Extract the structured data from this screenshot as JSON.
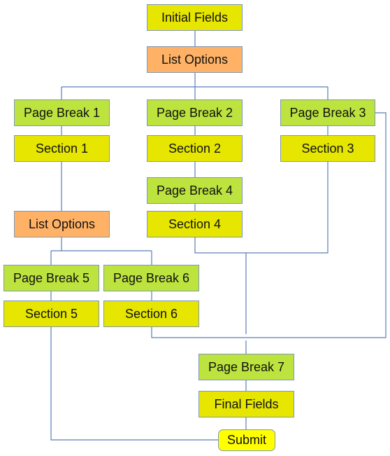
{
  "colors": {
    "section": "#e6e600",
    "page_break": "#bce33e",
    "list_options": "#ffb266",
    "submit": "#ffff00",
    "connector": "#5a7fb4"
  },
  "nodes": [
    {
      "id": "initial-fields",
      "label": "Initial Fields",
      "kind": "section"
    },
    {
      "id": "list-options-1",
      "label": "List Options",
      "kind": "list_options"
    },
    {
      "id": "page-break-1",
      "label": "Page Break 1",
      "kind": "page_break"
    },
    {
      "id": "page-break-2",
      "label": "Page Break 2",
      "kind": "page_break"
    },
    {
      "id": "page-break-3",
      "label": "Page Break 3",
      "kind": "page_break"
    },
    {
      "id": "section-1",
      "label": "Section 1",
      "kind": "section"
    },
    {
      "id": "section-2",
      "label": "Section 2",
      "kind": "section"
    },
    {
      "id": "section-3",
      "label": "Section 3",
      "kind": "section"
    },
    {
      "id": "page-break-4",
      "label": "Page Break 4",
      "kind": "page_break"
    },
    {
      "id": "section-4",
      "label": "Section 4",
      "kind": "section"
    },
    {
      "id": "list-options-2",
      "label": "List Options",
      "kind": "list_options"
    },
    {
      "id": "page-break-5",
      "label": "Page Break 5",
      "kind": "page_break"
    },
    {
      "id": "page-break-6",
      "label": "Page Break 6",
      "kind": "page_break"
    },
    {
      "id": "section-5",
      "label": "Section 5",
      "kind": "section"
    },
    {
      "id": "section-6",
      "label": "Section 6",
      "kind": "section"
    },
    {
      "id": "page-break-7",
      "label": "Page Break 7",
      "kind": "page_break"
    },
    {
      "id": "final-fields",
      "label": "Final Fields",
      "kind": "section"
    },
    {
      "id": "submit",
      "label": "Submit",
      "kind": "submit"
    }
  ],
  "edges": [
    [
      "initial-fields",
      "list-options-1"
    ],
    [
      "list-options-1",
      "page-break-1"
    ],
    [
      "list-options-1",
      "page-break-2"
    ],
    [
      "list-options-1",
      "page-break-3"
    ],
    [
      "page-break-1",
      "section-1"
    ],
    [
      "page-break-2",
      "section-2"
    ],
    [
      "page-break-3",
      "section-3"
    ],
    [
      "section-1",
      "list-options-2"
    ],
    [
      "section-2",
      "page-break-4"
    ],
    [
      "page-break-4",
      "section-4"
    ],
    [
      "list-options-2",
      "page-break-5"
    ],
    [
      "list-options-2",
      "page-break-6"
    ],
    [
      "page-break-5",
      "section-5"
    ],
    [
      "page-break-6",
      "section-6"
    ],
    [
      "section-4",
      "page-break-7"
    ],
    [
      "section-3",
      "page-break-7"
    ],
    [
      "section-6",
      "page-break-7"
    ],
    [
      "page-break-3",
      "page-break-7"
    ],
    [
      "page-break-7",
      "final-fields"
    ],
    [
      "final-fields",
      "submit"
    ],
    [
      "section-5",
      "submit"
    ]
  ]
}
